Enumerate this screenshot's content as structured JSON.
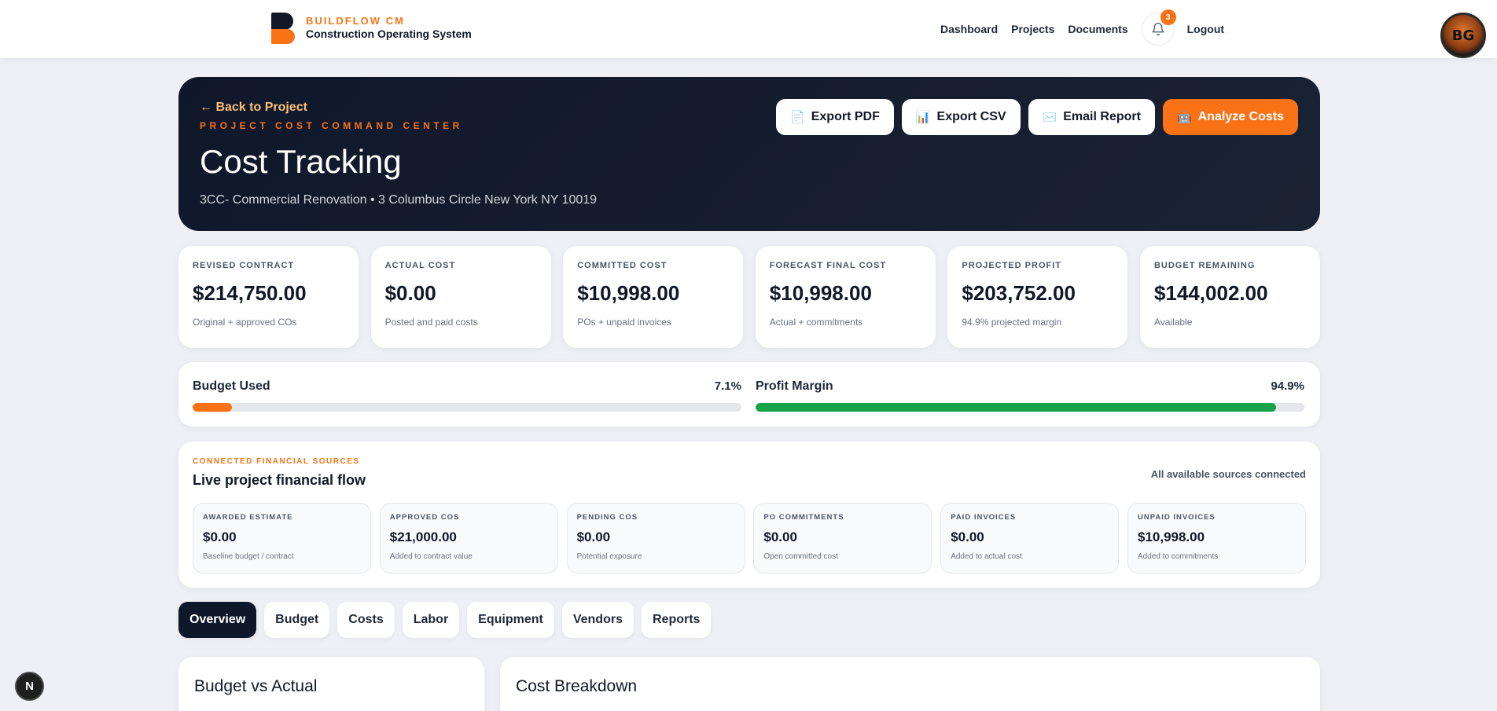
{
  "brand": {
    "name": "BUILDFLOW CM",
    "subtitle": "Construction Operating System"
  },
  "nav": {
    "links": [
      "Dashboard",
      "Projects",
      "Documents"
    ],
    "notifications_count": "3",
    "logout": "Logout",
    "avatar_text": "BG"
  },
  "hero": {
    "back_link": "← Back to Project",
    "kicker": "PROJECT COST COMMAND CENTER",
    "title": "Cost Tracking",
    "subtitle": "3CC- Commercial Renovation • 3 Columbus Circle New York NY 10019",
    "actions": [
      {
        "label": "Export PDF",
        "icon": "📄"
      },
      {
        "label": "Export CSV",
        "icon": "📊"
      },
      {
        "label": "Email Report",
        "icon": "✉️"
      },
      {
        "label": "Analyze Costs",
        "icon": "🤖"
      }
    ]
  },
  "stats": [
    {
      "label": "REVISED CONTRACT",
      "value": "$214,750.00",
      "note": "Original + approved COs"
    },
    {
      "label": "ACTUAL COST",
      "value": "$0.00",
      "note": "Posted and paid costs"
    },
    {
      "label": "COMMITTED COST",
      "value": "$10,998.00",
      "note": "POs + unpaid invoices"
    },
    {
      "label": "FORECAST FINAL COST",
      "value": "$10,998.00",
      "note": "Actual + commitments"
    },
    {
      "label": "PROJECTED PROFIT",
      "value": "$203,752.00",
      "note": "94.9% projected margin"
    },
    {
      "label": "BUDGET REMAINING",
      "value": "$144,002.00",
      "note": "Available"
    }
  ],
  "progress": {
    "budget": {
      "label": "Budget Used",
      "pct_text": "7.1%",
      "value": 7.1,
      "color": "#f97316"
    },
    "margin": {
      "label": "Profit Margin",
      "pct_text": "94.9%",
      "value": 94.9,
      "color": "#16a34a"
    }
  },
  "sources": {
    "kicker": "CONNECTED FINANCIAL SOURCES",
    "title": "Live project financial flow",
    "status": "All available sources connected",
    "items": [
      {
        "label": "AWARDED ESTIMATE",
        "value": "$0.00",
        "note": "Baseline budget / contract"
      },
      {
        "label": "APPROVED COS",
        "value": "$21,000.00",
        "note": "Added to contract value"
      },
      {
        "label": "PENDING COS",
        "value": "$0.00",
        "note": "Potential exposure"
      },
      {
        "label": "PO COMMITMENTS",
        "value": "$0.00",
        "note": "Open committed cost"
      },
      {
        "label": "PAID INVOICES",
        "value": "$0.00",
        "note": "Added to actual cost"
      },
      {
        "label": "UNPAID INVOICES",
        "value": "$10,998.00",
        "note": "Added to commitments"
      }
    ]
  },
  "tabs": [
    "Overview",
    "Budget",
    "Costs",
    "Labor",
    "Equipment",
    "Vendors",
    "Reports"
  ],
  "panels": {
    "left_title": "Budget vs Actual",
    "right_title": "Cost Breakdown"
  },
  "dev_badge": "N"
}
